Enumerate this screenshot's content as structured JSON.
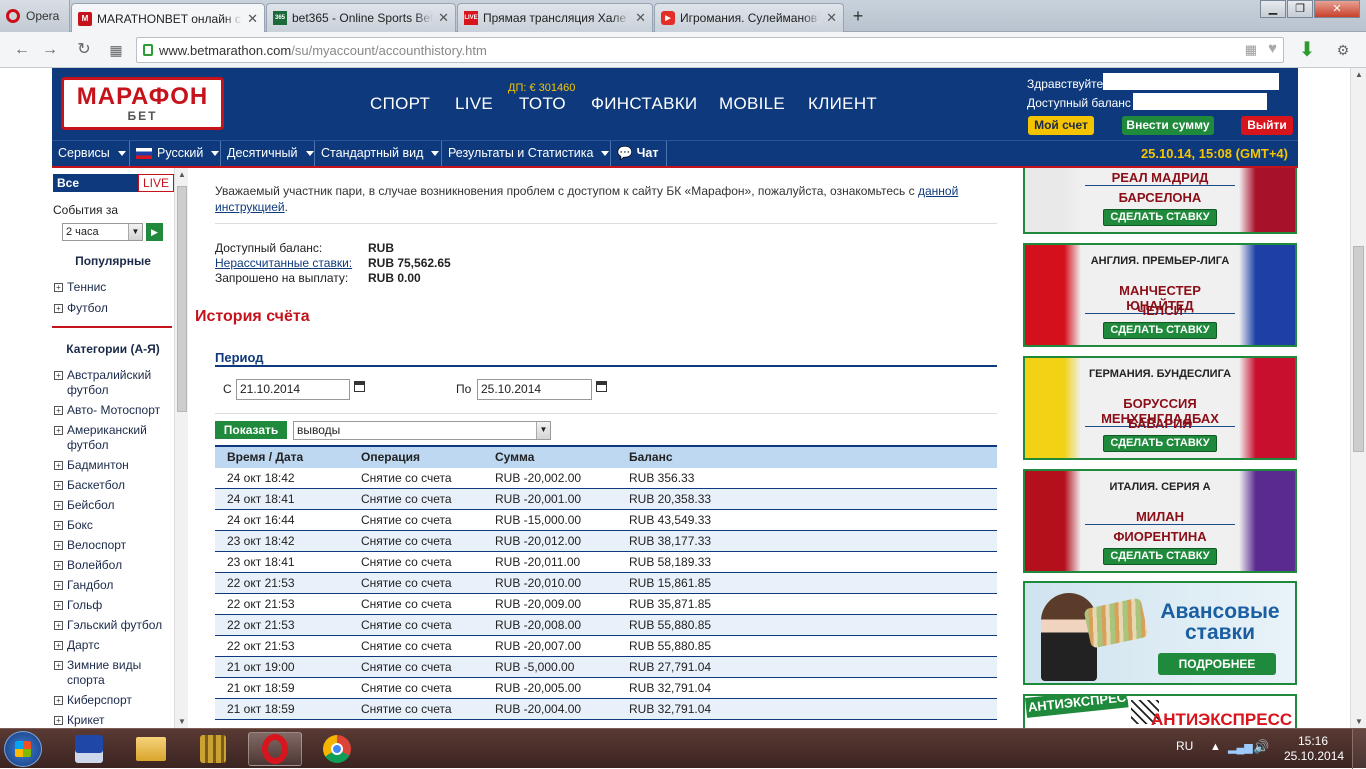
{
  "browser": {
    "opera_label": "Opera",
    "tabs": [
      {
        "title": "MARATHONBET онлайн с",
        "active": true
      },
      {
        "title": "bet365 - Online Sports Bett"
      },
      {
        "title": "Прямая трансляция Хале"
      },
      {
        "title": "Игромания. Сулейманов"
      }
    ],
    "url_host": "www.betmarathon.com",
    "url_path": "/su/myaccount/accounthistory.htm"
  },
  "header": {
    "logo_line1": "МАРАФОН",
    "logo_line2": "БЕТ",
    "jackpot": "ДП: € 301460",
    "nav": [
      "СПОРТ",
      "LIVE",
      "ТОТО",
      "ФИНСТАВКИ",
      "MOBILE",
      "КЛИЕНТ"
    ],
    "hello_label": "Здравствуйте",
    "balance_label": "Доступный баланс",
    "my_account": "Мой счет",
    "deposit": "Внести сумму",
    "logout": "Выйти"
  },
  "menubar": {
    "items": [
      "Сервисы",
      "Русский",
      "Десятичный",
      "Стандартный вид",
      "Результаты и Статистика",
      "Чат"
    ],
    "datetime": "25.10.14, 15:08 (GMT+4)"
  },
  "sidebar": {
    "tab_all": "Все события",
    "tab_live": "LIVE",
    "events_for": "События за",
    "period_value": "2 часа",
    "popular": "Популярные",
    "popular_items": [
      "Теннис",
      "Футбол"
    ],
    "categories": "Категории (А-Я)",
    "category_items": [
      "Австралийский футбол",
      "Авто- Мотоспорт",
      "Американский футбол",
      "Бадминтон",
      "Баскетбол",
      "Бейсбол",
      "Бокс",
      "Велоспорт",
      "Волейбол",
      "Гандбол",
      "Гольф",
      "Гэльский футбол",
      "Дартс",
      "Зимние виды спорта",
      "Киберспорт",
      "Крикет"
    ]
  },
  "main": {
    "notice_text": "Уважаемый участник пари, в случае возникновения проблем с доступом к сайту БК «Марафон», пожалуйста, ознакомьтесь с ",
    "notice_link": "данной инструкцией",
    "notice_end": ".",
    "balance_rows": [
      {
        "label": "Доступный баланс:",
        "value": "RUB"
      },
      {
        "label": "Нерассчитанные ставки:",
        "value": "RUB 75,562.65"
      },
      {
        "label": "Запрошено на выплату:",
        "value": "RUB 0.00"
      }
    ],
    "title": "История счёта",
    "period_label": "Период",
    "from_label": "С",
    "from_value": "21.10.2014",
    "to_label": "По",
    "to_value": "25.10.2014",
    "show_button": "Показать",
    "type_value": "выводы",
    "columns": [
      "Время / Дата",
      "Операция",
      "Сумма",
      "Баланс"
    ],
    "rows": [
      [
        "24 окт 18:42",
        "Снятие со счета",
        "RUB -20,002.00",
        "RUB 356.33"
      ],
      [
        "24 окт 18:41",
        "Снятие со счета",
        "RUB -20,001.00",
        "RUB 20,358.33"
      ],
      [
        "24 окт 16:44",
        "Снятие со счета",
        "RUB -15,000.00",
        "RUB 43,549.33"
      ],
      [
        "23 окт 18:42",
        "Снятие со счета",
        "RUB -20,012.00",
        "RUB 38,177.33"
      ],
      [
        "23 окт 18:41",
        "Снятие со счета",
        "RUB -20,011.00",
        "RUB 58,189.33"
      ],
      [
        "22 окт 21:53",
        "Снятие со счета",
        "RUB -20,010.00",
        "RUB 15,861.85"
      ],
      [
        "22 окт 21:53",
        "Снятие со счета",
        "RUB -20,009.00",
        "RUB 35,871.85"
      ],
      [
        "22 окт 21:53",
        "Снятие со счета",
        "RUB -20,008.00",
        "RUB 55,880.85"
      ],
      [
        "22 окт 21:53",
        "Снятие со счета",
        "RUB -20,007.00",
        "RUB 55,880.85"
      ],
      [
        "21 окт 19:00",
        "Снятие со счета",
        "RUB -5,000.00",
        "RUB 27,791.04"
      ],
      [
        "21 окт 18:59",
        "Снятие со счета",
        "RUB -20,005.00",
        "RUB 32,791.04"
      ],
      [
        "21 окт 18:59",
        "Снятие со счета",
        "RUB -20,004.00",
        "RUB 32,791.04"
      ]
    ]
  },
  "banners": [
    {
      "league": "",
      "team1": "РЕАЛ МАДРИД",
      "team2": "БАРСЕЛОНА",
      "stake": "СДЕЛАТЬ СТАВКУ",
      "colorL": "#e9e9e9",
      "colorR": "#a8112a"
    },
    {
      "league": "АНГЛИЯ. ПРЕМЬЕР-ЛИГА",
      "team1": "МАНЧЕСТЕР ЮНАЙТЕД",
      "team2": "ЧЕЛСИ",
      "stake": "СДЕЛАТЬ СТАВКУ",
      "colorL": "#d3101c",
      "colorR": "#1d3fa6"
    },
    {
      "league": "ГЕРМАНИЯ. БУНДЕСЛИГА",
      "team1": "БОРУССИЯ МЕНХЕНГЛАДБАХ",
      "team2": "БАВАРИЯ",
      "stake": "СДЕЛАТЬ СТАВКУ",
      "colorL": "#f1d215",
      "colorR": "#c8102e"
    },
    {
      "league": "ИТАЛИЯ. СЕРИЯ А",
      "team1": "МИЛАН",
      "team2": "ФИОРЕНТИНА",
      "stake": "СДЕЛАТЬ СТАВКУ",
      "colorL": "#b3101c",
      "colorR": "#5a2a91"
    }
  ],
  "advance": {
    "line1": "Авансовые",
    "line2": "ставки",
    "button": "ПОДРОБНЕЕ"
  },
  "antiexpress": {
    "left": "АНТИЭКСПРЕСС",
    "right": "АНТИЭКСПРЕСС"
  },
  "taskbar": {
    "lang": "RU",
    "time": "15:16",
    "date": "25.10.2014"
  }
}
